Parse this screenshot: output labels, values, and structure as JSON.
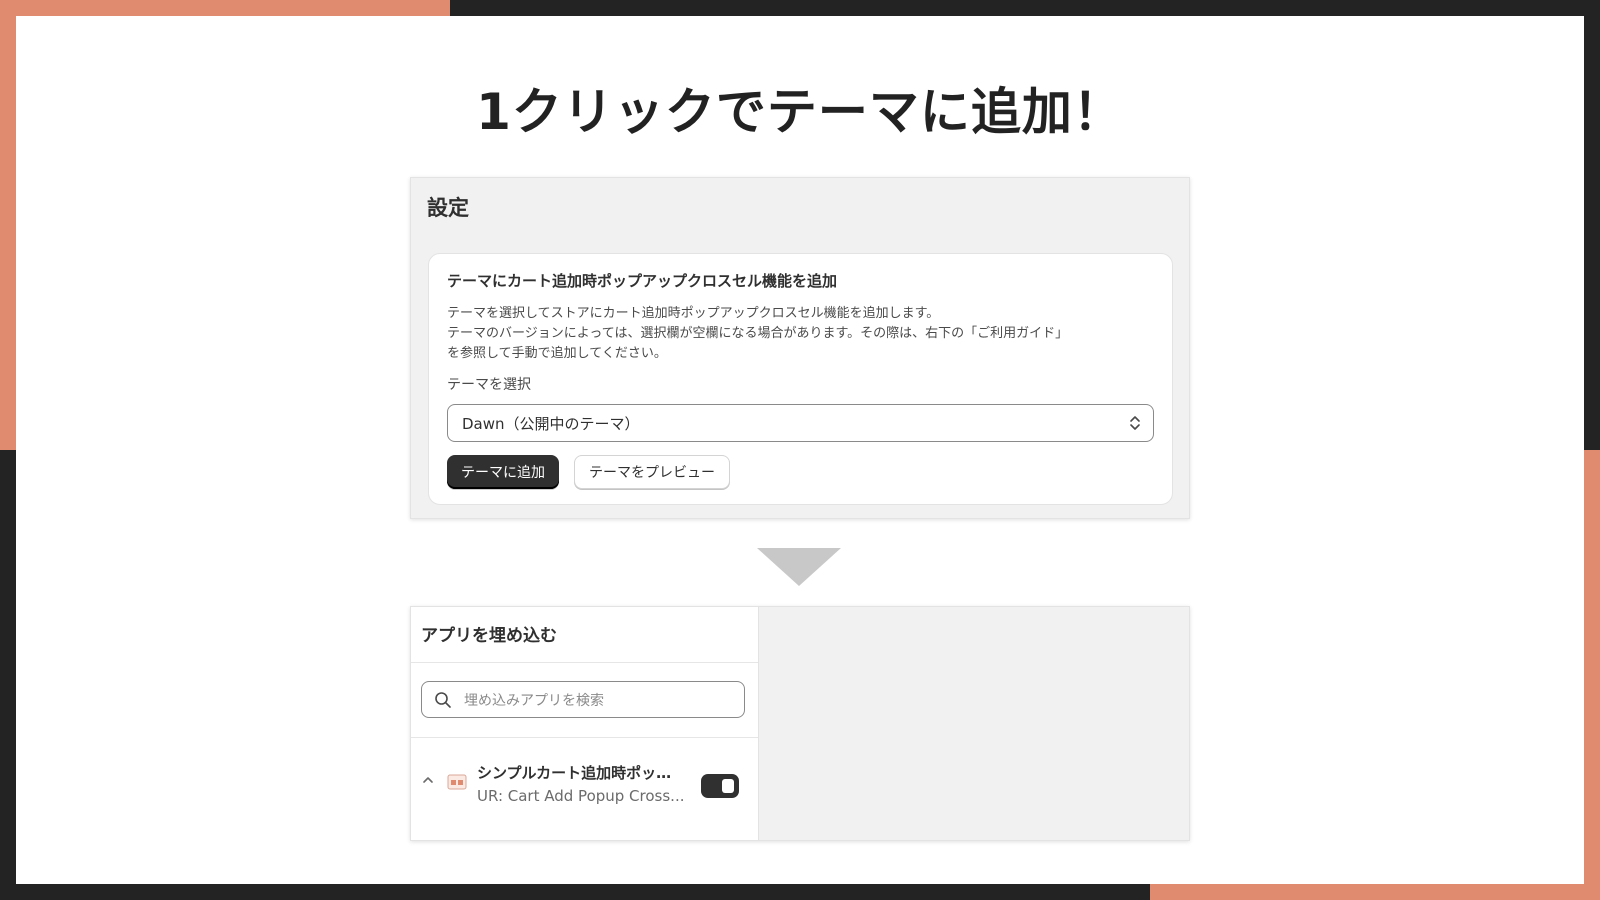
{
  "colors": {
    "accent": "#e08b70",
    "frame_dark": "#232323",
    "primary_button": "#303030"
  },
  "headline": "1クリックでテーマに追加！",
  "settings": {
    "title": "設定",
    "card_title": "テーマにカート追加時ポップアップクロスセル機能を追加",
    "description_lines": [
      "テーマを選択してストアにカート追加時ポップアップクロスセル機能を追加します。",
      "テーマのバージョンによっては、選択欄が空欄になる場合があります。その際は、右下の「ご利用ガイド」",
      "を参照して手動で追加してください。"
    ],
    "select_label": "テーマを選択",
    "select_value": "Dawn（公開中のテーマ）",
    "add_button": "テーマに追加",
    "preview_button": "テーマをプレビュー"
  },
  "embed": {
    "title": "アプリを埋め込む",
    "search_placeholder": "埋め込みアプリを検索",
    "app": {
      "name": "シンプルカート追加時ポッ…",
      "subtitle": "UR: Cart Add Popup Cross...",
      "enabled": true
    }
  }
}
